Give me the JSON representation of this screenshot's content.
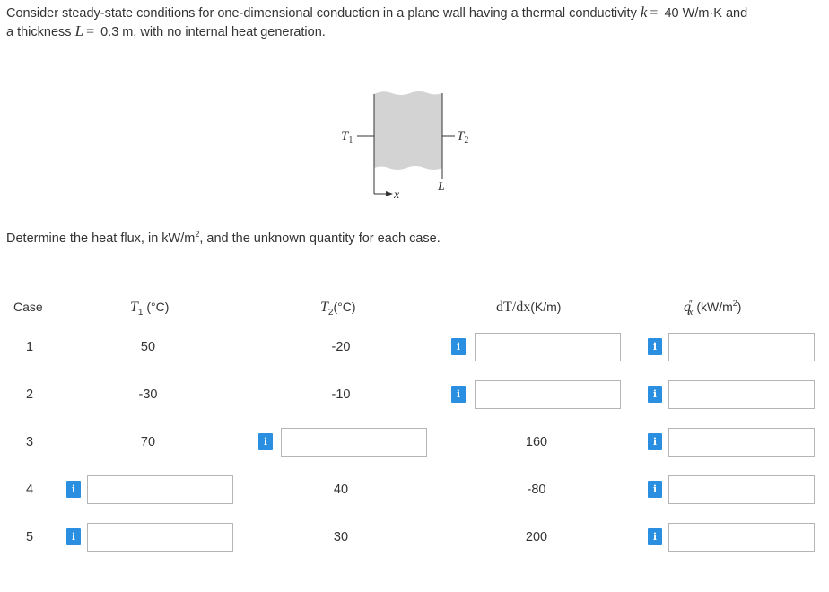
{
  "problem": {
    "text_before_k": "Consider steady-state conditions for one-dimensional conduction in a plane wall having a thermal conductivity",
    "k_symbol": "k",
    "equals": "=",
    "k_value": "40 W/m·K and",
    "text_before_L": "a thickness",
    "L_symbol": "L",
    "L_value": "0.3 m, with no internal heat generation."
  },
  "figure": {
    "label_t1": "T",
    "label_t1_sub": "1",
    "label_t2": "T",
    "label_t2_sub": "2",
    "label_L": "L",
    "label_x": "x",
    "wall_color": "#d3d3d3"
  },
  "instruction": {
    "text_before": "Determine the heat flux, in kW/m",
    "sup": "2",
    "text_after": ", and the unknown quantity for each case."
  },
  "table": {
    "headers": {
      "case": "Case",
      "t1_sym": "T",
      "t1_sub": "1",
      "t1_unit": "(°C)",
      "t2_sym": "T",
      "t2_sub": "2",
      "t2_unit": "(°C)",
      "dtdx_sym": "dT/dx",
      "dtdx_unit": "(K/m)",
      "q_sym": "q",
      "q_marks": "″",
      "q_sub": "x",
      "q_unit": "(kW/m",
      "q_sup": "2",
      "q_close": ")"
    },
    "rows": [
      {
        "case": "1",
        "t1": "50",
        "t2": "-20",
        "dtdx": "",
        "q": ""
      },
      {
        "case": "2",
        "t1": "-30",
        "t2": "-10",
        "dtdx": "",
        "q": ""
      },
      {
        "case": "3",
        "t1": "70",
        "t2": "",
        "dtdx": "160",
        "q": ""
      },
      {
        "case": "4",
        "t1": "",
        "t2": "40",
        "dtdx": "-80",
        "q": ""
      },
      {
        "case": "5",
        "t1": "",
        "t2": "30",
        "dtdx": "200",
        "q": ""
      }
    ],
    "info_glyph": "i"
  },
  "colors": {
    "info_button": "#2a8fe0",
    "input_border": "#b5b5b5",
    "text": "#333333"
  }
}
